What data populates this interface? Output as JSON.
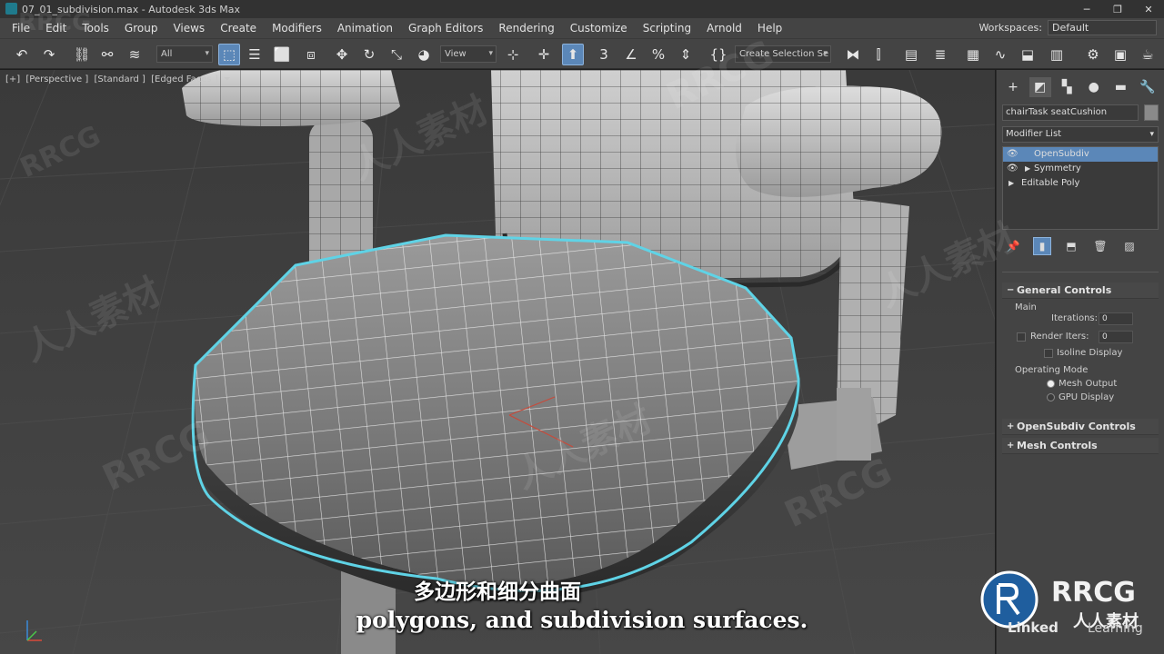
{
  "window": {
    "title": "07_01_subdivision.max - Autodesk 3ds Max",
    "controls": [
      "─",
      "❐",
      "✕"
    ]
  },
  "menu": {
    "items": [
      "File",
      "Edit",
      "Tools",
      "Group",
      "Views",
      "Create",
      "Modifiers",
      "Animation",
      "Graph Editors",
      "Rendering",
      "Customize",
      "Scripting",
      "Arnold",
      "Help"
    ],
    "workspaces_label": "Workspaces:",
    "workspace_value": "Default"
  },
  "toolbar": {
    "filter_value": "All",
    "coord_value": "View",
    "selection_set_value": "Create Selection Se",
    "snap_label": "3",
    "percent_label": "%"
  },
  "viewport": {
    "labels": [
      "[+]",
      "[Perspective ]",
      "[Standard ]",
      "[Edged Faces ]"
    ],
    "filter_icon": "funnel-icon"
  },
  "command_panel": {
    "tabs": [
      "create-icon",
      "modify-icon",
      "hierarchy-icon",
      "motion-icon",
      "display-icon",
      "utilities-icon"
    ],
    "object_name": "chairTask seatCushion",
    "modifier_list_label": "Modifier List",
    "stack": [
      {
        "label": "OpenSubdiv",
        "selected": true,
        "eye": true,
        "arrow": false
      },
      {
        "label": "Symmetry",
        "selected": false,
        "eye": true,
        "arrow": true
      },
      {
        "label": "Editable Poly",
        "selected": false,
        "eye": false,
        "arrow": true
      }
    ],
    "general_controls": {
      "title": "General Controls",
      "main_label": "Main",
      "iterations_label": "Iterations:",
      "iterations_value": "0",
      "render_iters_label": "Render Iters:",
      "render_iters_value": "0",
      "isoline_label": "Isoline Display",
      "operating_mode_label": "Operating Mode",
      "mesh_output_label": "Mesh Output",
      "gpu_display_label": "GPU Display"
    },
    "opensubdiv_controls_title": "OpenSubdiv Controls",
    "mesh_controls_title": "Mesh Controls"
  },
  "subtitles": {
    "chinese": "多边形和细分曲面",
    "english": "polygons, and subdivision surfaces."
  },
  "branding": {
    "rrcg_text": "RRCG",
    "rrcg_cn": "人人素材",
    "linkedin_text": "Linked",
    "linkedin_sub": "Learning",
    "watermark_text": "RRCG",
    "watermark_cn": "人人素材"
  },
  "colors": {
    "selection_outline": "#5fd3e6",
    "accent_blue": "#5b87b8"
  }
}
